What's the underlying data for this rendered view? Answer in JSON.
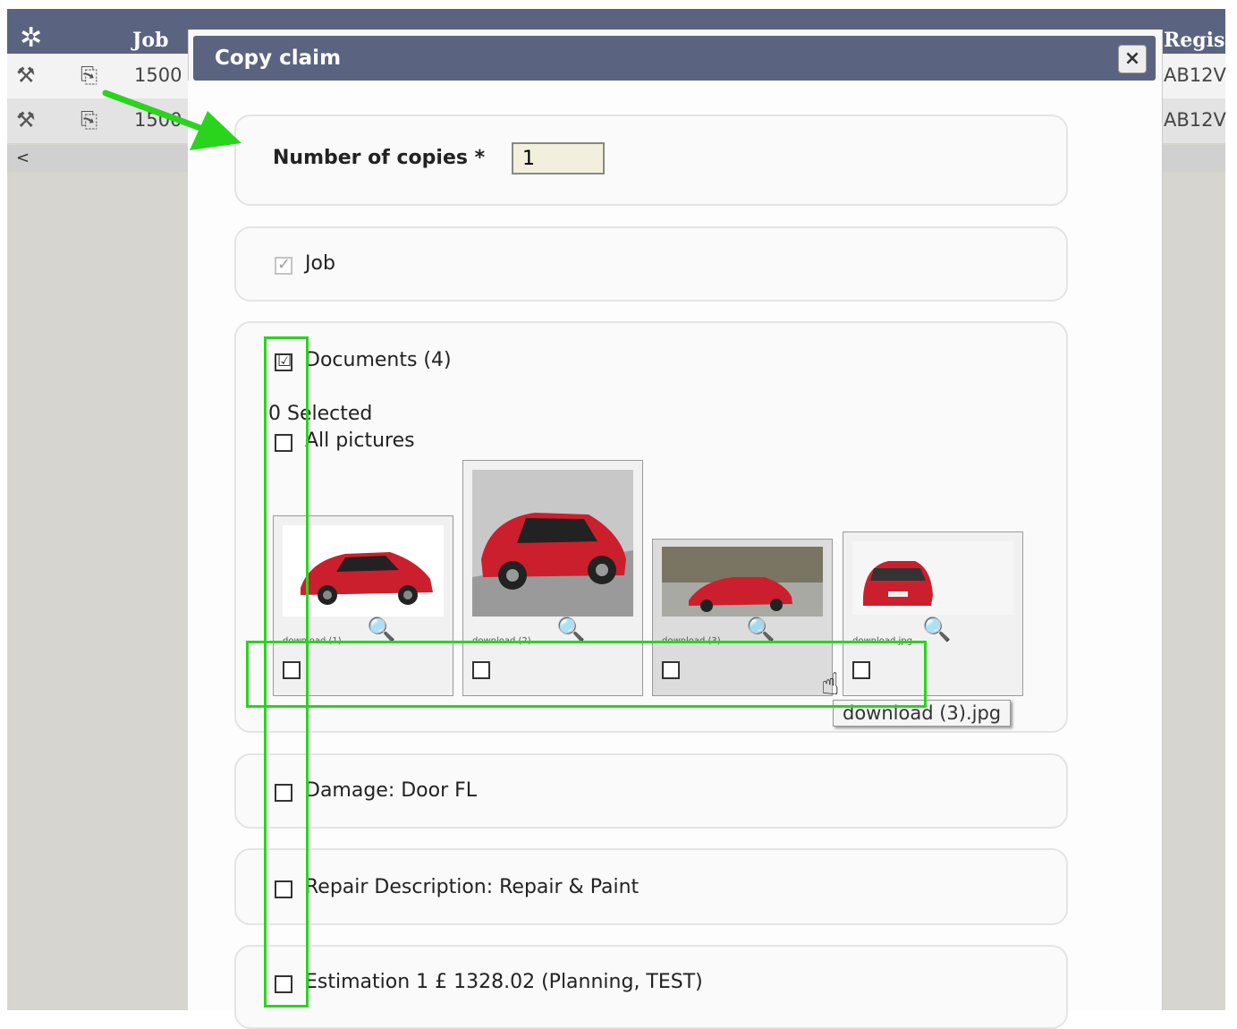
{
  "background_table": {
    "header": {
      "job_label": "Job",
      "reg_label": "Regist"
    },
    "rows": [
      {
        "job": "1500",
        "reg": "AB12V"
      },
      {
        "job": "1500",
        "reg": "AB12V"
      }
    ],
    "scroll_left": "<"
  },
  "dialog": {
    "title": "Copy claim",
    "close_label": "×",
    "copies_label": "Number of copies *",
    "copies_value": "1",
    "job": {
      "label": "Job",
      "checked": true,
      "disabled": true
    },
    "documents": {
      "label": "Documents (4)",
      "selected_text": "0 Selected",
      "all_pictures_label": "All pictures",
      "thumbnails": [
        {
          "caption": "download (1)...",
          "color": "#cc1f2e"
        },
        {
          "caption": "download (2)...",
          "color": "#cc1f2e"
        },
        {
          "caption": "download (3)...",
          "color": "#cc1f2e"
        },
        {
          "caption": "download.jpg",
          "color": "#cc1f2e"
        }
      ]
    },
    "damage_label": "Damage: Door FL",
    "repair_label": "Repair Description: Repair & Paint",
    "estimation_label": "Estimation 1 £ 1328.02 (Planning, TEST)"
  },
  "tooltip": "download (3).jpg",
  "annotation_color": "#2ad41d"
}
